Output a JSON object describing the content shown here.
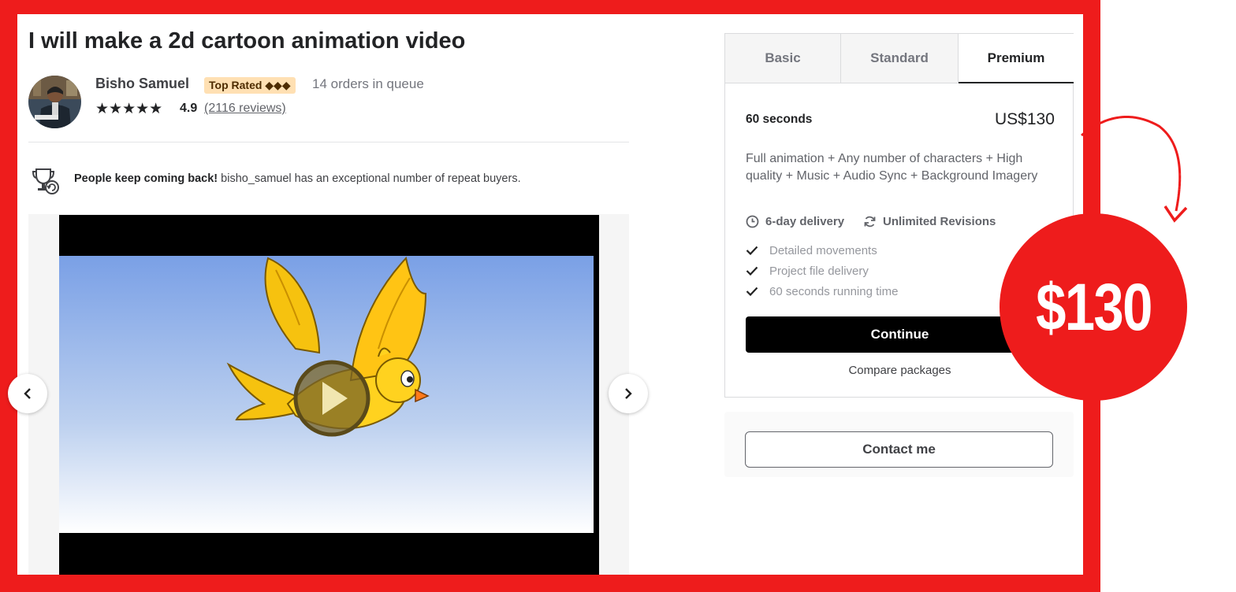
{
  "gig": {
    "title": "I will make a 2d cartoon animation video"
  },
  "seller": {
    "name": "Bisho Samuel",
    "badge": "Top Rated ◆◆◆",
    "queue": "14 orders in queue",
    "stars": "★★★★★",
    "rating": "4.9",
    "reviews": "(2116 reviews)"
  },
  "highlight": {
    "icon": "trophy-repeat-icon",
    "bold": "People keep coming back!",
    "text": " bisho_samuel has an exceptional number of repeat buyers."
  },
  "gallery": {
    "prev_icon": "chevron-left-icon",
    "next_icon": "chevron-right-icon",
    "play_icon": "play-icon"
  },
  "packages": {
    "tabs": [
      "Basic",
      "Standard",
      "Premium"
    ],
    "active_tab": "Premium",
    "name": "60 seconds",
    "price": "US$130",
    "description": "Full animation + Any number of characters + High quality + Music + Audio Sync + Background Imagery",
    "delivery": "6-day delivery",
    "revisions": "Unlimited Revisions",
    "features": [
      "Detailed movements",
      "Project file delivery",
      "60 seconds running time"
    ],
    "continue_label": "Continue",
    "compare_label": "Compare packages"
  },
  "contact": {
    "label": "Contact me"
  },
  "promo": {
    "price": "$130",
    "color": "#ee1c1c"
  }
}
